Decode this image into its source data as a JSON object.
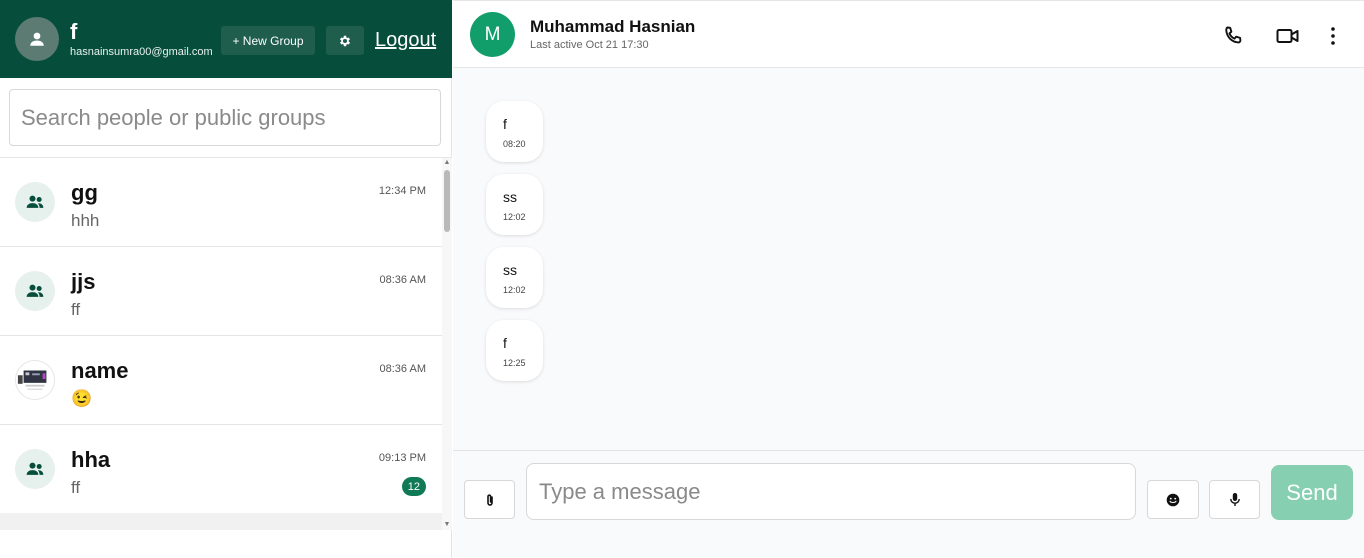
{
  "profile": {
    "name": "f",
    "email": "hasnainsumra00@gmail.com"
  },
  "toolbar": {
    "new_group_label": "+ New Group",
    "logout_label": "Logout"
  },
  "search": {
    "placeholder": "Search people or public groups"
  },
  "conversations": [
    {
      "name": "gg",
      "preview": "hhh",
      "time": "12:34 PM",
      "avatar": "group-icon",
      "unread": ""
    },
    {
      "name": "jjs",
      "preview": "ff",
      "time": "08:36 AM",
      "avatar": "group-icon",
      "unread": ""
    },
    {
      "name": "name",
      "preview": "😉",
      "time": "08:36 AM",
      "avatar": "photo",
      "unread": ""
    },
    {
      "name": "hha",
      "preview": "ff",
      "time": "09:13 PM",
      "avatar": "group-icon",
      "unread": "12"
    }
  ],
  "chat": {
    "contact_initial": "M",
    "contact_name": "Muhammad Hasnian",
    "status": "Last active Oct 21 17:30",
    "messages": [
      {
        "text": "f",
        "time": "08:20"
      },
      {
        "text": "ss",
        "time": "12:02"
      },
      {
        "text": "ss",
        "time": "12:02"
      },
      {
        "text": "f",
        "time": "12:25"
      }
    ]
  },
  "composer": {
    "placeholder": "Type a message",
    "send_label": "Send"
  },
  "colors": {
    "brand": "#064e3b",
    "accent": "#129e6a",
    "badge": "#0f7a55",
    "send_disabled": "#86cfb0"
  }
}
